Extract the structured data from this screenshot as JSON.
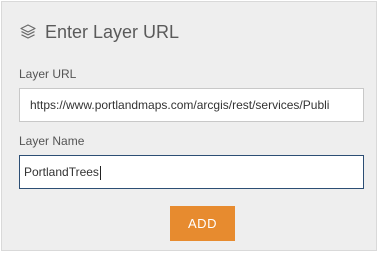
{
  "header": {
    "icon": "layers-icon",
    "title": "Enter Layer URL"
  },
  "form": {
    "url_label": "Layer URL",
    "url_value": "https://www.portlandmaps.com/arcgis/rest/services/Publi",
    "name_label": "Layer Name",
    "name_value": "PortlandTrees",
    "add_label": "ADD"
  },
  "colors": {
    "panel_bg": "#eeeeee",
    "accent_button": "#e78b2f",
    "focused_border": "#2c4e74"
  }
}
